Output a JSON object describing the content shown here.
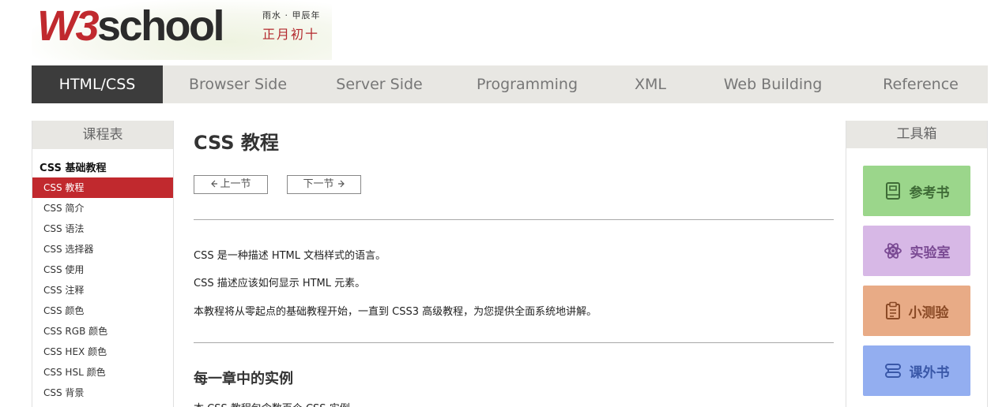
{
  "header": {
    "logo_w3": "W3",
    "logo_school": "school",
    "date_small": "雨水 · 甲辰年",
    "date_main": "正月初十"
  },
  "nav": {
    "items": [
      {
        "label": "HTML/CSS",
        "active": true
      },
      {
        "label": "Browser Side"
      },
      {
        "label": "Server Side"
      },
      {
        "label": "Programming"
      },
      {
        "label": "XML"
      },
      {
        "label": "Web Building"
      },
      {
        "label": "Reference"
      }
    ]
  },
  "sidebar": {
    "title": "课程表",
    "section": "CSS 基础教程",
    "items": [
      {
        "label": "CSS 教程",
        "active": true
      },
      {
        "label": "CSS 简介"
      },
      {
        "label": "CSS 语法"
      },
      {
        "label": "CSS 选择器"
      },
      {
        "label": "CSS 使用"
      },
      {
        "label": "CSS 注释"
      },
      {
        "label": "CSS 颜色"
      },
      {
        "label": "CSS RGB 颜色"
      },
      {
        "label": "CSS HEX 颜色"
      },
      {
        "label": "CSS HSL 颜色"
      },
      {
        "label": "CSS 背景"
      }
    ]
  },
  "main": {
    "title": "CSS 教程",
    "prev_label": "上一节",
    "next_label": "下一节",
    "paragraphs": [
      "CSS 是一种描述 HTML 文档样式的语言。",
      "CSS 描述应该如何显示 HTML 元素。",
      "本教程将从零起点的基础教程开始，一直到 CSS3 高级教程，为您提供全面系统地讲解。"
    ],
    "section_heading": "每一章中的实例",
    "section_text": "本 CSS 教程包含数百个 CSS 实例。"
  },
  "toolbox": {
    "title": "工具箱",
    "tools": [
      {
        "label": "参考书",
        "icon": "book-icon",
        "color": "#9bd68b"
      },
      {
        "label": "实验室",
        "icon": "atom-icon",
        "color": "#d7b8e6"
      },
      {
        "label": "小测验",
        "icon": "clipboard-icon",
        "color": "#e8ab86"
      },
      {
        "label": "课外书",
        "icon": "books-icon",
        "color": "#93aef0"
      }
    ]
  },
  "colors": {
    "accent_red": "#c1292e",
    "nav_active_bg": "#3c3c3c",
    "panel_bg": "#e8e7e3"
  }
}
